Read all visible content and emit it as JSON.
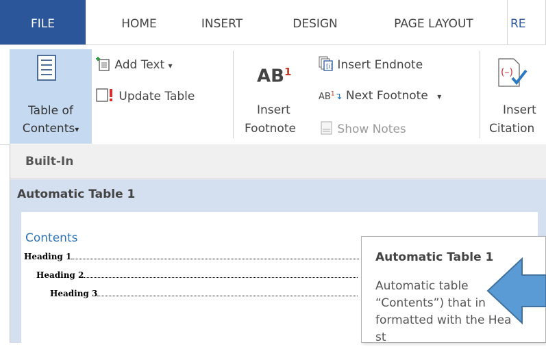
{
  "tabs": {
    "file": "FILE",
    "home": "HOME",
    "insert": "INSERT",
    "design": "DESIGN",
    "page_layout": "PAGE LAYOUT",
    "references_partial": "RE"
  },
  "ribbon": {
    "toc_line1": "Table of",
    "toc_line2": "Contents",
    "add_text": "Add Text",
    "update_table": "Update Table",
    "insert_footnote_line1": "Insert",
    "insert_footnote_line2": "Footnote",
    "insert_footnote_icon_text": "AB",
    "insert_footnote_icon_sup": "1",
    "insert_endnote": "Insert Endnote",
    "next_footnote": "Next Footnote",
    "next_footnote_icon_text": "AB",
    "next_footnote_icon_sup": "1",
    "show_notes": "Show Notes",
    "insert_citation_line1": "Insert",
    "insert_citation_line2": "Citation",
    "dropdown_caret": "▾"
  },
  "gallery": {
    "section_header": "Built-In",
    "item_title": "Automatic Table 1",
    "preview": {
      "contents": "Contents",
      "heading1": "Heading 1",
      "heading2": "Heading 2",
      "heading3": "Heading 3"
    }
  },
  "tooltip": {
    "title": "Automatic Table 1",
    "line1": "Automatic table",
    "line2": "“Contents”) that in",
    "line3": "formatted with the Hea",
    "line4": "st"
  },
  "colors": {
    "file_tab": "#2b579a",
    "selected_button": "#c5d9f1",
    "gallery_highlight": "#d4e0f0",
    "arrow": "#5b9bd5",
    "footnote_red": "#c0392b"
  }
}
